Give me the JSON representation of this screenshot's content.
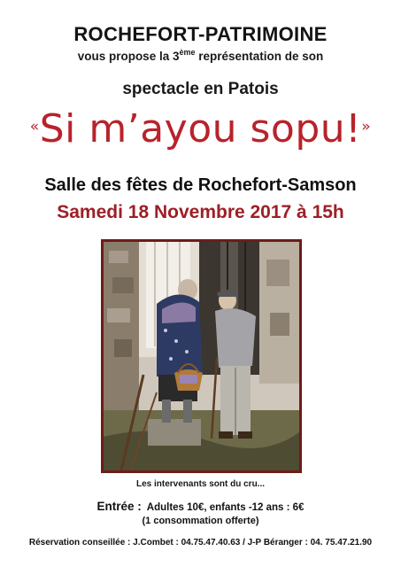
{
  "header": {
    "organization": "ROCHEFORT-PATRIMOINE",
    "proposal_before": "vous propose la 3",
    "proposal_sup": "ème",
    "proposal_after": " représentation de son",
    "subtitle": "spectacle en Patois"
  },
  "show": {
    "open_quote": "«",
    "title": "Si m’ayou sopu!",
    "close_quote": "»"
  },
  "event": {
    "venue": "Salle des fêtes de Rochefort-Samson",
    "date": "Samedi 18 Novembre 2017 à 15h"
  },
  "photo": {
    "caption": "Les intervenants sont du cru..."
  },
  "tickets": {
    "label": "Entrée :",
    "prices": "Adultes 10€, enfants -12 ans : 6€",
    "note": "(1 consommation offerte)"
  },
  "reservation": {
    "text": "Réservation conseillée : J.Combet : 04.75.47.40.63 / J-P Béranger : 04. 75.47.21.90"
  },
  "colors": {
    "title_red": "#b8232b",
    "date_red": "#9d1f26",
    "frame": "#6d1c1a"
  }
}
